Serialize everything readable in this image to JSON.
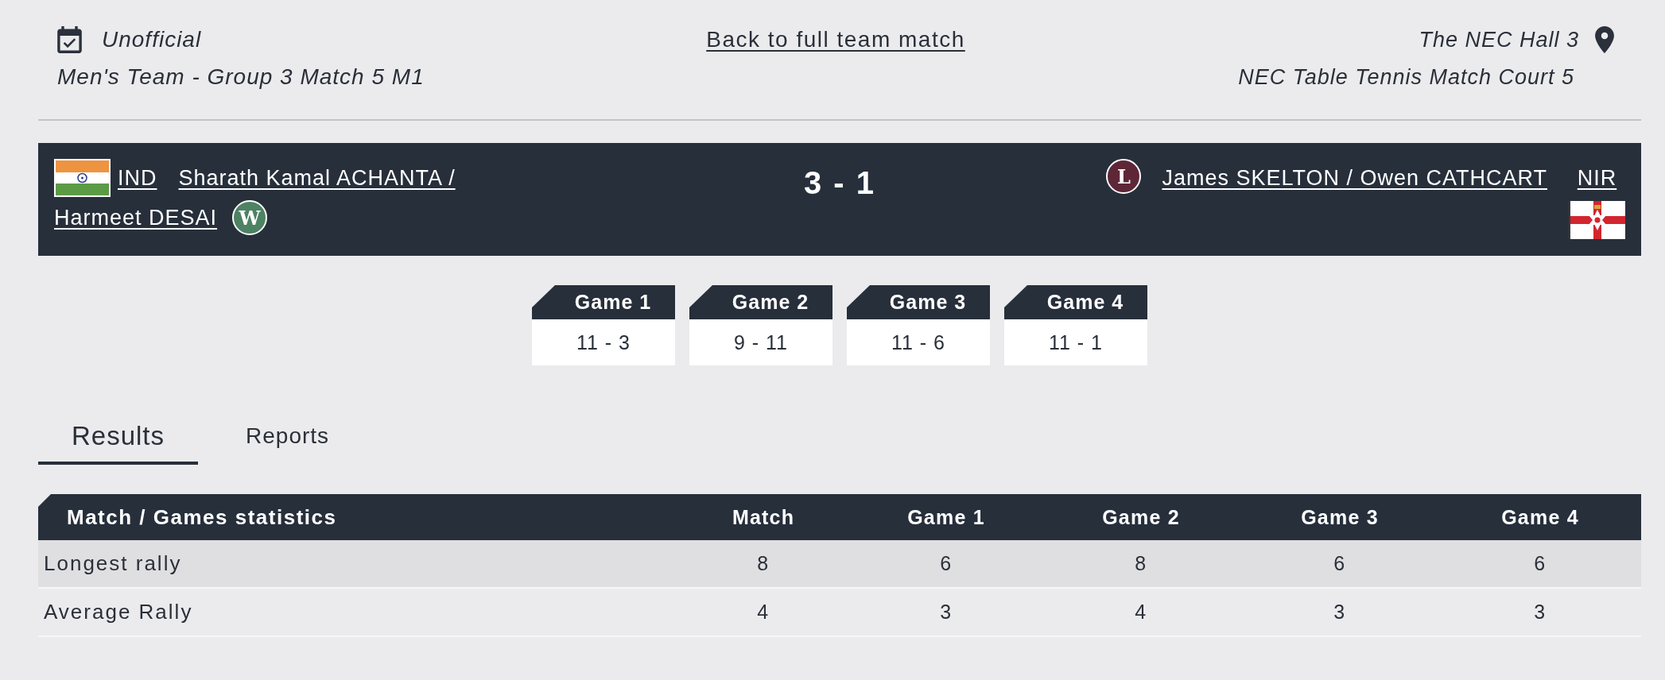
{
  "header": {
    "status": "Unofficial",
    "event": "Men's Team - Group 3 Match 5 M1",
    "back_link": "Back to full team match",
    "venue": "The NEC Hall 3",
    "court": "NEC Table Tennis Match Court 5"
  },
  "match": {
    "score": "3 - 1",
    "teams": [
      {
        "kind": "home",
        "country": "IND",
        "name_lines": [
          "Sharath Kamal ACHANTA /",
          "Harmeet DESAI"
        ],
        "result": {
          "label": "W",
          "won": true
        }
      },
      {
        "kind": "away",
        "country": "NIR",
        "name_lines": [
          "James SKELTON / Owen CATHCART"
        ],
        "result": {
          "label": "L",
          "won": false
        }
      }
    ]
  },
  "games": [
    {
      "label": "Game 1",
      "score": "11 - 3"
    },
    {
      "label": "Game 2",
      "score": "9 - 11"
    },
    {
      "label": "Game 3",
      "score": "11 - 6"
    },
    {
      "label": "Game 4",
      "score": "11 - 1"
    }
  ],
  "tabs": [
    {
      "label": "Results",
      "selected": true
    },
    {
      "label": "Reports",
      "selected": false
    }
  ],
  "stats": {
    "columns": [
      "Match / Games statistics",
      "Match",
      "Game 1",
      "Game 2",
      "Game 3",
      "Game 4"
    ],
    "rows": [
      {
        "label": "Longest rally",
        "values": [
          "8",
          "6",
          "8",
          "6",
          "6"
        ]
      },
      {
        "label": "Average Rally",
        "values": [
          "4",
          "3",
          "4",
          "3",
          "3"
        ]
      }
    ]
  }
}
